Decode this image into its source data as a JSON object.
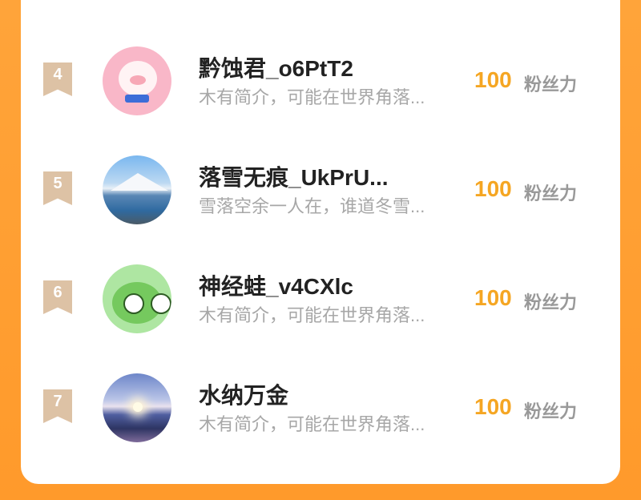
{
  "ranking": [
    {
      "rank": "4",
      "name": "黔蚀君_o6PtT2",
      "bio": "木有简介，可能在世界角落...",
      "count": "100",
      "fans_label": "粉丝力",
      "avatar_icon": "pig-avatar-icon"
    },
    {
      "rank": "5",
      "name": "落雪无痕_UkPrU...",
      "bio": "雪落空余一人在，谁道冬雪...",
      "count": "100",
      "fans_label": "粉丝力",
      "avatar_icon": "lake-mountain-avatar-icon"
    },
    {
      "rank": "6",
      "name": "神经蛙_v4CXlc",
      "bio": "木有简介，可能在世界角落...",
      "count": "100",
      "fans_label": "粉丝力",
      "avatar_icon": "frog-avatar-icon"
    },
    {
      "rank": "7",
      "name": "水纳万金",
      "bio": "木有简介，可能在世界角落...",
      "count": "100",
      "fans_label": "粉丝力",
      "avatar_icon": "sunset-avatar-icon"
    }
  ],
  "colors": {
    "background": "#ff9a2b",
    "count": "#f5a623",
    "rank_badge": "#ddc2a5",
    "bio": "#a7a7a7"
  }
}
